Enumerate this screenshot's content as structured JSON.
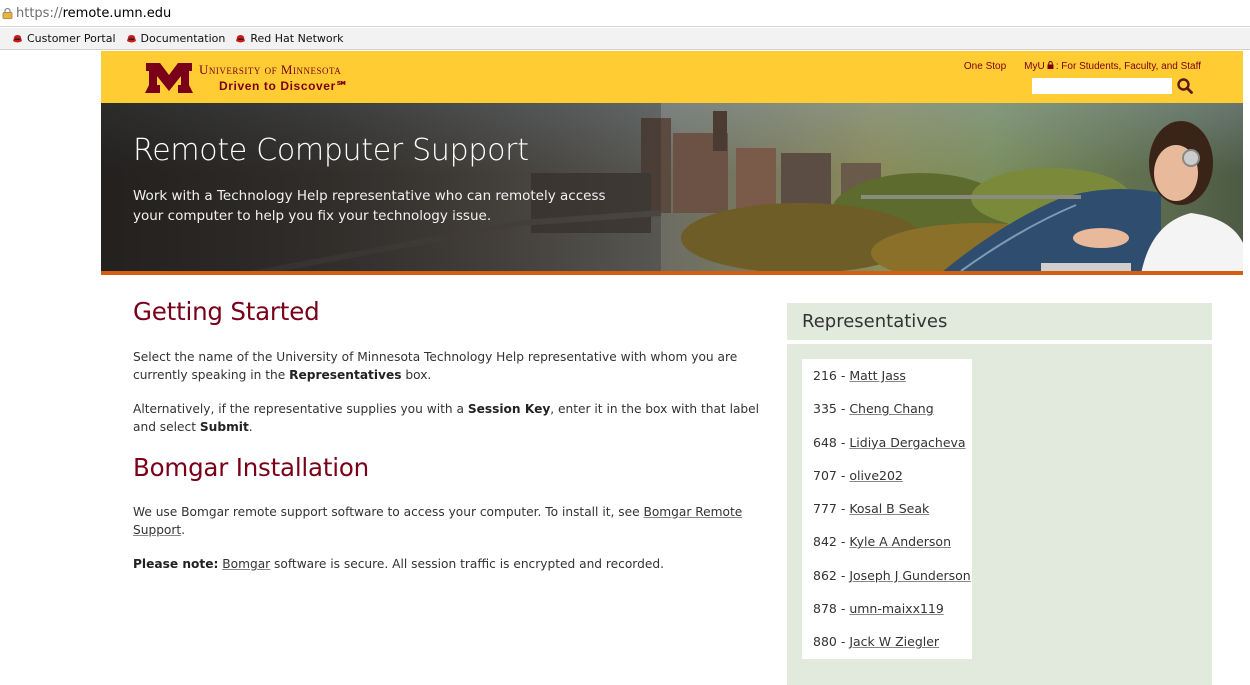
{
  "browser": {
    "url_scheme": "https://",
    "url_host": "remote.umn.edu",
    "bookmarks": [
      "Customer Portal",
      "Documentation",
      "Red Hat Network"
    ]
  },
  "header": {
    "university_name": "University of Minnesota",
    "tagline": "Driven to Discover℠",
    "link_one_stop": "One Stop",
    "link_myu": "MyU",
    "link_myu_suffix": ": For Students, Faculty, and Staff",
    "search_placeholder": ""
  },
  "hero": {
    "title": "Remote Computer Support",
    "subtitle": "Work with a Technology Help representative who can remotely access your computer to help you fix your technology issue."
  },
  "main": {
    "getting_started_heading": "Getting Started",
    "gs_p1_a": "Select the name of the University of Minnesota Technology Help representative with whom you are currently speaking in the ",
    "gs_p1_b": "Representatives",
    "gs_p1_c": " box.",
    "gs_p2_a": "Alternatively, if the representative supplies you with a ",
    "gs_p2_b": "Session Key",
    "gs_p2_c": ", enter it in the box with that label and select ",
    "gs_p2_d": "Submit",
    "gs_p2_e": ".",
    "bomgar_heading": "Bomgar Installation",
    "bi_p1_a": "We use Bomgar remote support software to access your computer. To install it, see ",
    "bi_p1_link": "Bomgar Remote Support",
    "bi_p1_c": ".",
    "bi_p2_a": "Please note:",
    "bi_p2_link": "Bomgar",
    "bi_p2_c": " software is secure. All session traffic is encrypted and recorded."
  },
  "representatives": {
    "title": "Representatives",
    "items": [
      {
        "id": "216",
        "name": "Matt Jass"
      },
      {
        "id": "335",
        "name": "Cheng Chang"
      },
      {
        "id": "648",
        "name": "Lidiya Dergacheva"
      },
      {
        "id": "707",
        "name": "olive202"
      },
      {
        "id": "777",
        "name": "Kosal B Seak"
      },
      {
        "id": "842",
        "name": "Kyle A Anderson"
      },
      {
        "id": "862",
        "name": "Joseph J Gunderson"
      },
      {
        "id": "878",
        "name": "umn-maixx119"
      },
      {
        "id": "880",
        "name": "Jack W Ziegler"
      }
    ]
  },
  "colors": {
    "maroon": "#7a0019",
    "gold": "#ffcc33",
    "panel_green": "#e1eadc",
    "hero_stripe": "#d45f13"
  }
}
